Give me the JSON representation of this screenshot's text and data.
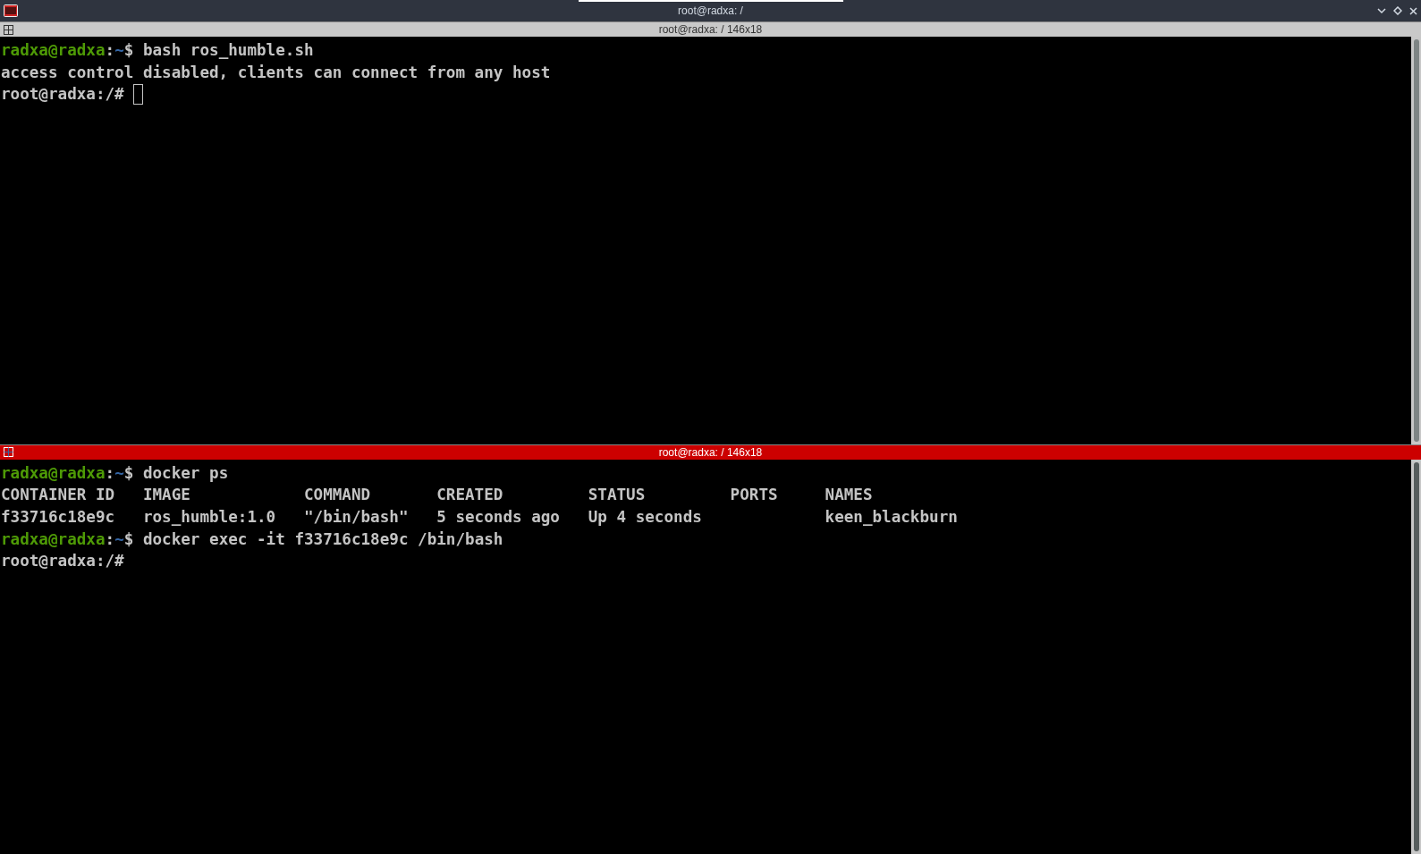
{
  "window": {
    "title": "root@radxa: /"
  },
  "panes": [
    {
      "title": "root@radxa: / 146x18",
      "focused": false,
      "lines": [
        {
          "segments": [
            {
              "kind": "user",
              "text": "radxa@radxa"
            },
            {
              "kind": "plain",
              "text": ":"
            },
            {
              "kind": "path",
              "text": "~"
            },
            {
              "kind": "plain",
              "text": "$ bash ros_humble.sh"
            }
          ]
        },
        {
          "segments": [
            {
              "kind": "plain",
              "text": "access control disabled, clients can connect from any host"
            }
          ]
        },
        {
          "segments": [
            {
              "kind": "plain",
              "text": "root@radxa:/# "
            }
          ],
          "cursor": true
        }
      ]
    },
    {
      "title": "root@radxa: / 146x18",
      "focused": true,
      "lines": [
        {
          "segments": [
            {
              "kind": "user",
              "text": "radxa@radxa"
            },
            {
              "kind": "plain",
              "text": ":"
            },
            {
              "kind": "path",
              "text": "~"
            },
            {
              "kind": "plain",
              "text": "$ docker ps"
            }
          ]
        },
        {
          "segments": [
            {
              "kind": "plain",
              "text": "CONTAINER ID   IMAGE            COMMAND       CREATED         STATUS         PORTS     NAMES"
            }
          ]
        },
        {
          "segments": [
            {
              "kind": "plain",
              "text": "f33716c18e9c   ros_humble:1.0   \"/bin/bash\"   5 seconds ago   Up 4 seconds             keen_blackburn"
            }
          ]
        },
        {
          "segments": [
            {
              "kind": "user",
              "text": "radxa@radxa"
            },
            {
              "kind": "plain",
              "text": ":"
            },
            {
              "kind": "path",
              "text": "~"
            },
            {
              "kind": "plain",
              "text": "$ docker exec -it f33716c18e9c /bin/bash"
            }
          ]
        },
        {
          "segments": [
            {
              "kind": "plain",
              "text": "root@radxa:/#"
            }
          ],
          "cursor": false
        }
      ]
    }
  ]
}
